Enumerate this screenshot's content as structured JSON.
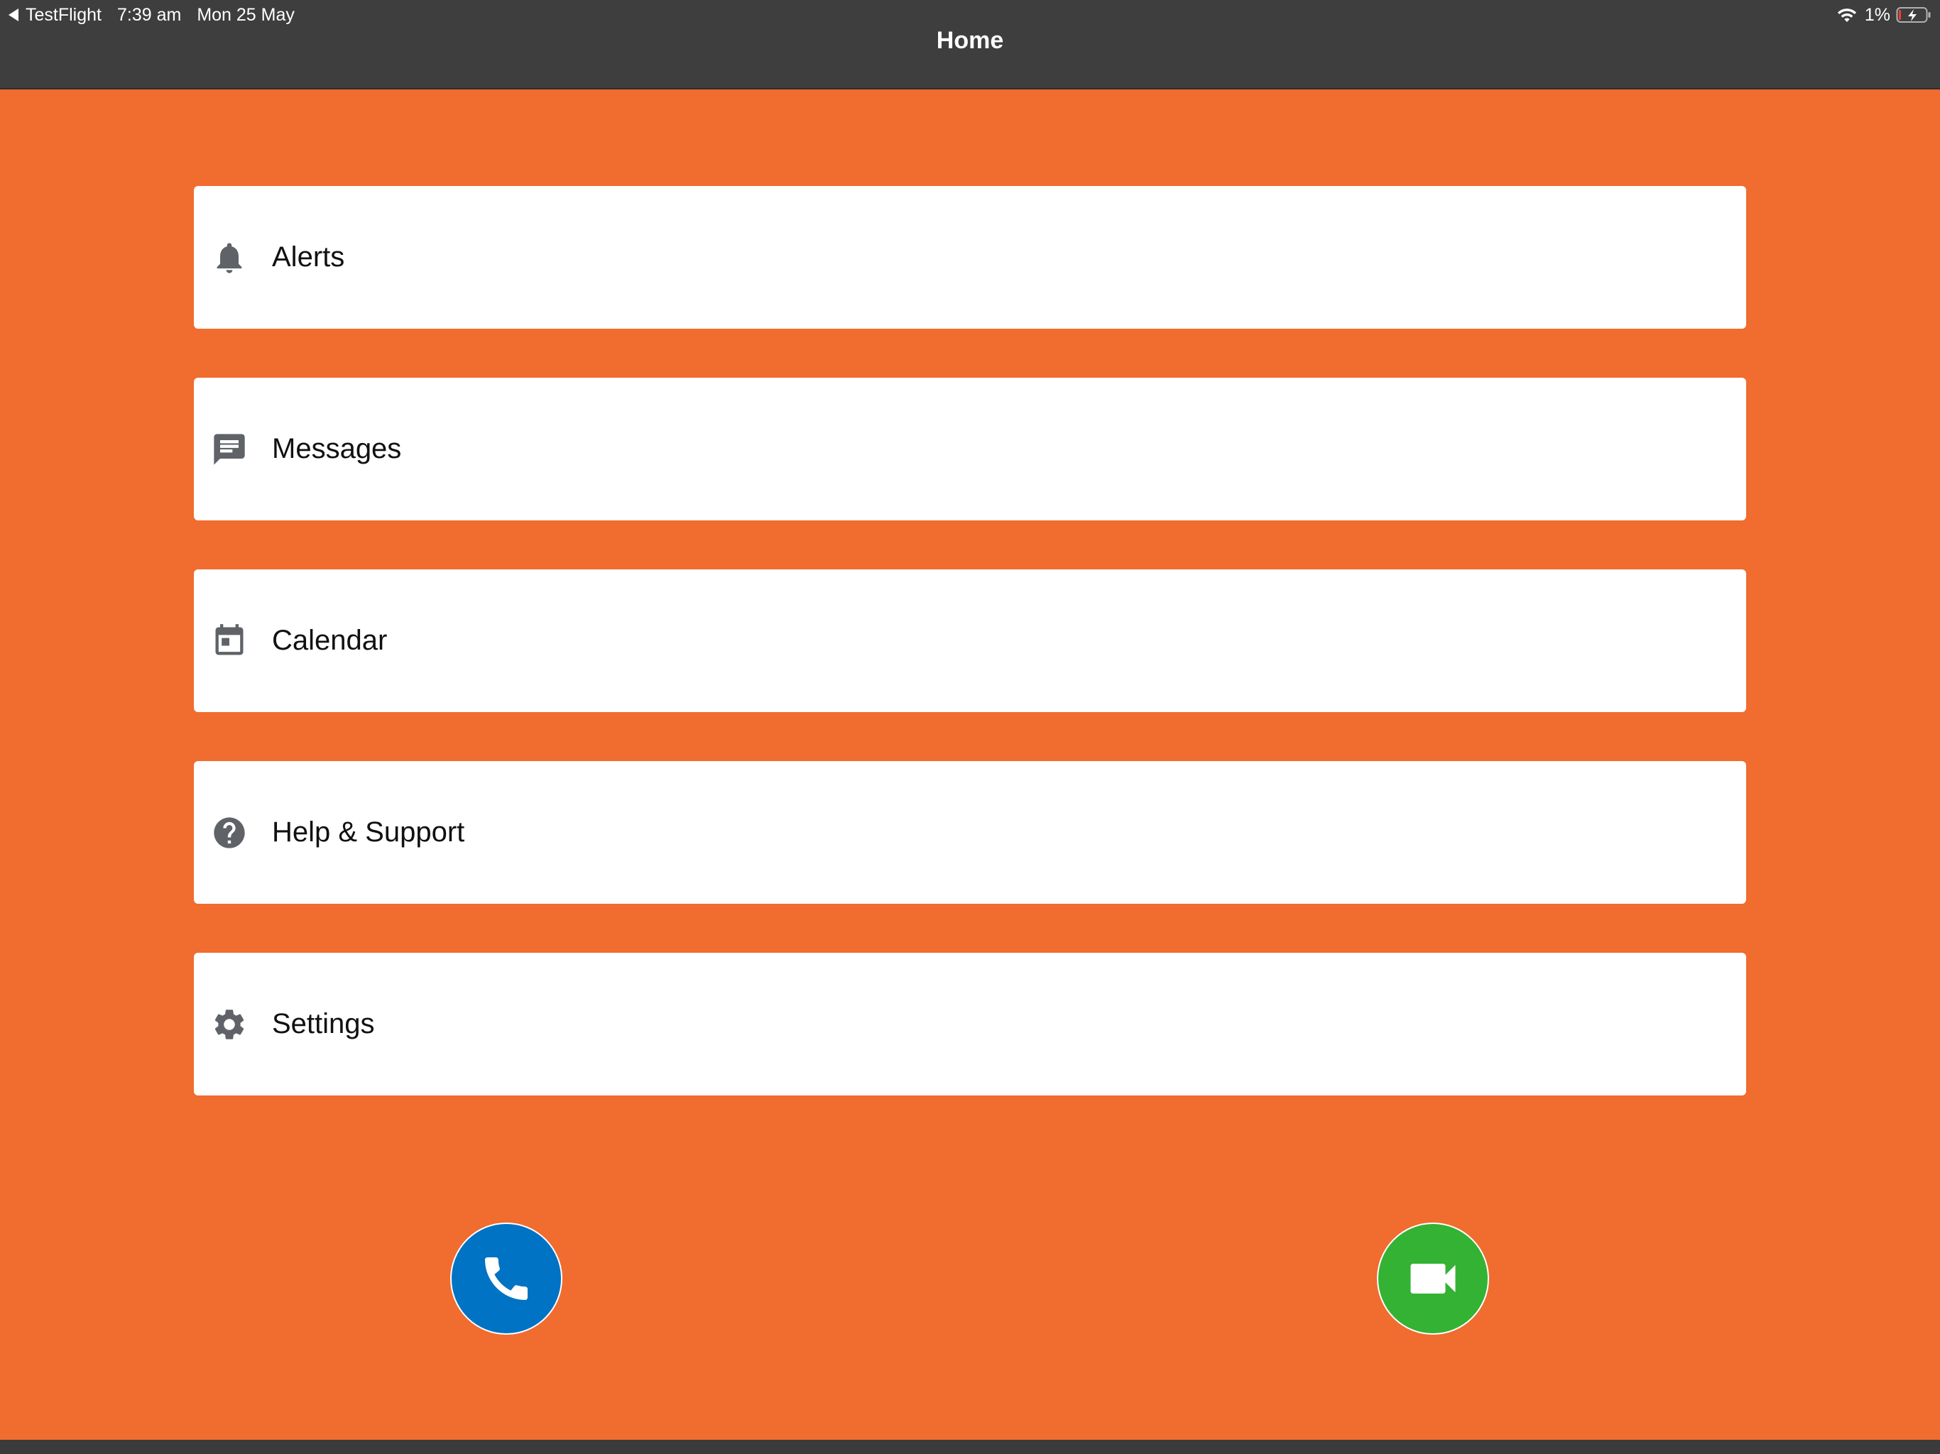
{
  "status_bar": {
    "back_app": "TestFlight",
    "time": "7:39 am",
    "date": "Mon 25 May",
    "battery_percent": "1%",
    "wifi_icon": "wifi-icon",
    "battery_icon": "battery-charging-icon"
  },
  "header": {
    "title": "Home"
  },
  "menu": {
    "items": [
      {
        "label": "Alerts",
        "icon": "bell-icon"
      },
      {
        "label": "Messages",
        "icon": "message-icon"
      },
      {
        "label": "Calendar",
        "icon": "calendar-icon"
      },
      {
        "label": "Help & Support",
        "icon": "help-icon"
      },
      {
        "label": "Settings",
        "icon": "gear-icon"
      }
    ]
  },
  "actions": {
    "phone": {
      "icon": "phone-icon",
      "color": "#0073c4"
    },
    "video": {
      "icon": "video-camera-icon",
      "color": "#34b233"
    }
  },
  "colors": {
    "background": "#f06c2f",
    "header": "#3e3e3e",
    "card": "#ffffff",
    "icon": "#5f6368"
  }
}
